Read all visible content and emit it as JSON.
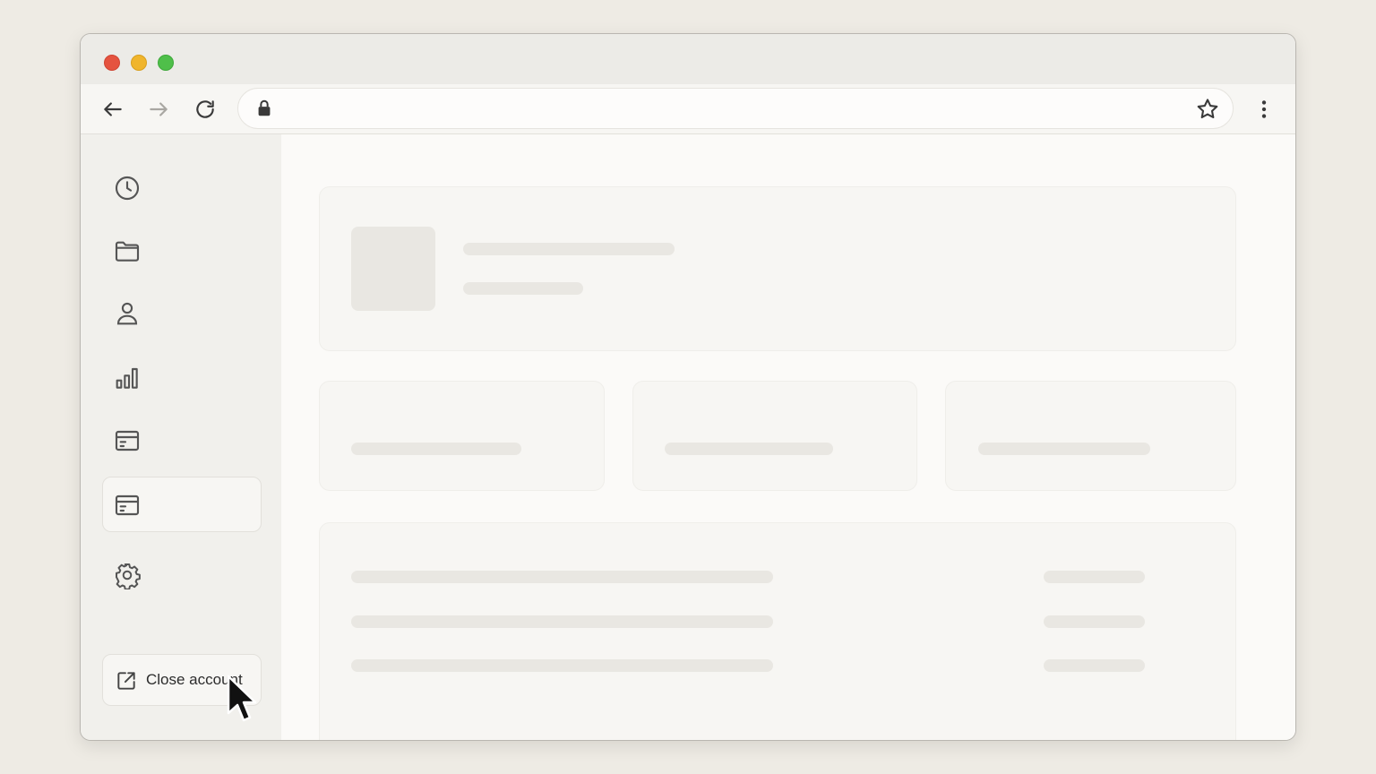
{
  "browser": {
    "window_controls": [
      "close",
      "minimize",
      "maximize"
    ],
    "toolbar": {
      "back_icon": "arrow-left-icon",
      "forward_icon": "arrow-right-icon",
      "reload_icon": "reload-icon",
      "menu_icon": "kebab-menu-icon"
    },
    "address_bar": {
      "value": "",
      "lock_icon": "lock-icon",
      "bookmark_icon": "star-icon"
    }
  },
  "sidebar": {
    "items": [
      {
        "icon": "clock-icon",
        "active": false
      },
      {
        "icon": "folder-icon",
        "active": false
      },
      {
        "icon": "user-icon",
        "active": false
      },
      {
        "icon": "bar-chart-icon",
        "active": false
      },
      {
        "icon": "card-icon",
        "active": false
      },
      {
        "icon": "card-icon",
        "active": true
      },
      {
        "icon": "gear-icon",
        "active": false
      }
    ],
    "close_account": {
      "label": "Close account",
      "icon": "external-link-icon"
    }
  },
  "content": {
    "state": "loading-skeleton",
    "stat_cards": 3,
    "table_rows": 3
  },
  "colors": {
    "background": "#eeebe4",
    "close": "#e5533f",
    "minimize": "#f0b52c",
    "maximize": "#4fbf4a",
    "skeleton": "#e9e7e2"
  }
}
